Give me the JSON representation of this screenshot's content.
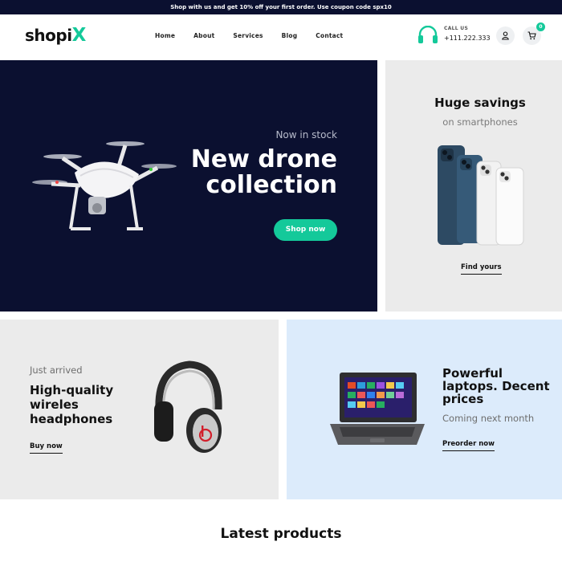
{
  "topbar": {
    "message": "Shop with us and get 10% off your first order. Use coupon code spx10"
  },
  "header": {
    "logo_main": "shopi",
    "logo_accent": "X",
    "nav": [
      "Home",
      "About",
      "Services",
      "Blog",
      "Contact"
    ],
    "call_label": "CALL US",
    "call_number": "+111.222.333",
    "cart_count": "0",
    "colors": {
      "accent": "#14c99a",
      "dark": "#0b1030"
    }
  },
  "hero": {
    "kicker": "Now in stock",
    "title": "New drone collection",
    "button": "Shop now"
  },
  "promo_phones": {
    "title": "Huge savings",
    "subtitle": "on smartphones",
    "link": "Find yours"
  },
  "promo_headphones": {
    "kicker": "Just arrived",
    "title": "High-quality wireles headphones",
    "link": "Buy now"
  },
  "promo_laptops": {
    "title": "Powerful laptops. Decent prices",
    "subtitle": "Coming next month",
    "link": "Preorder now"
  },
  "latest": {
    "heading": "Latest products"
  }
}
